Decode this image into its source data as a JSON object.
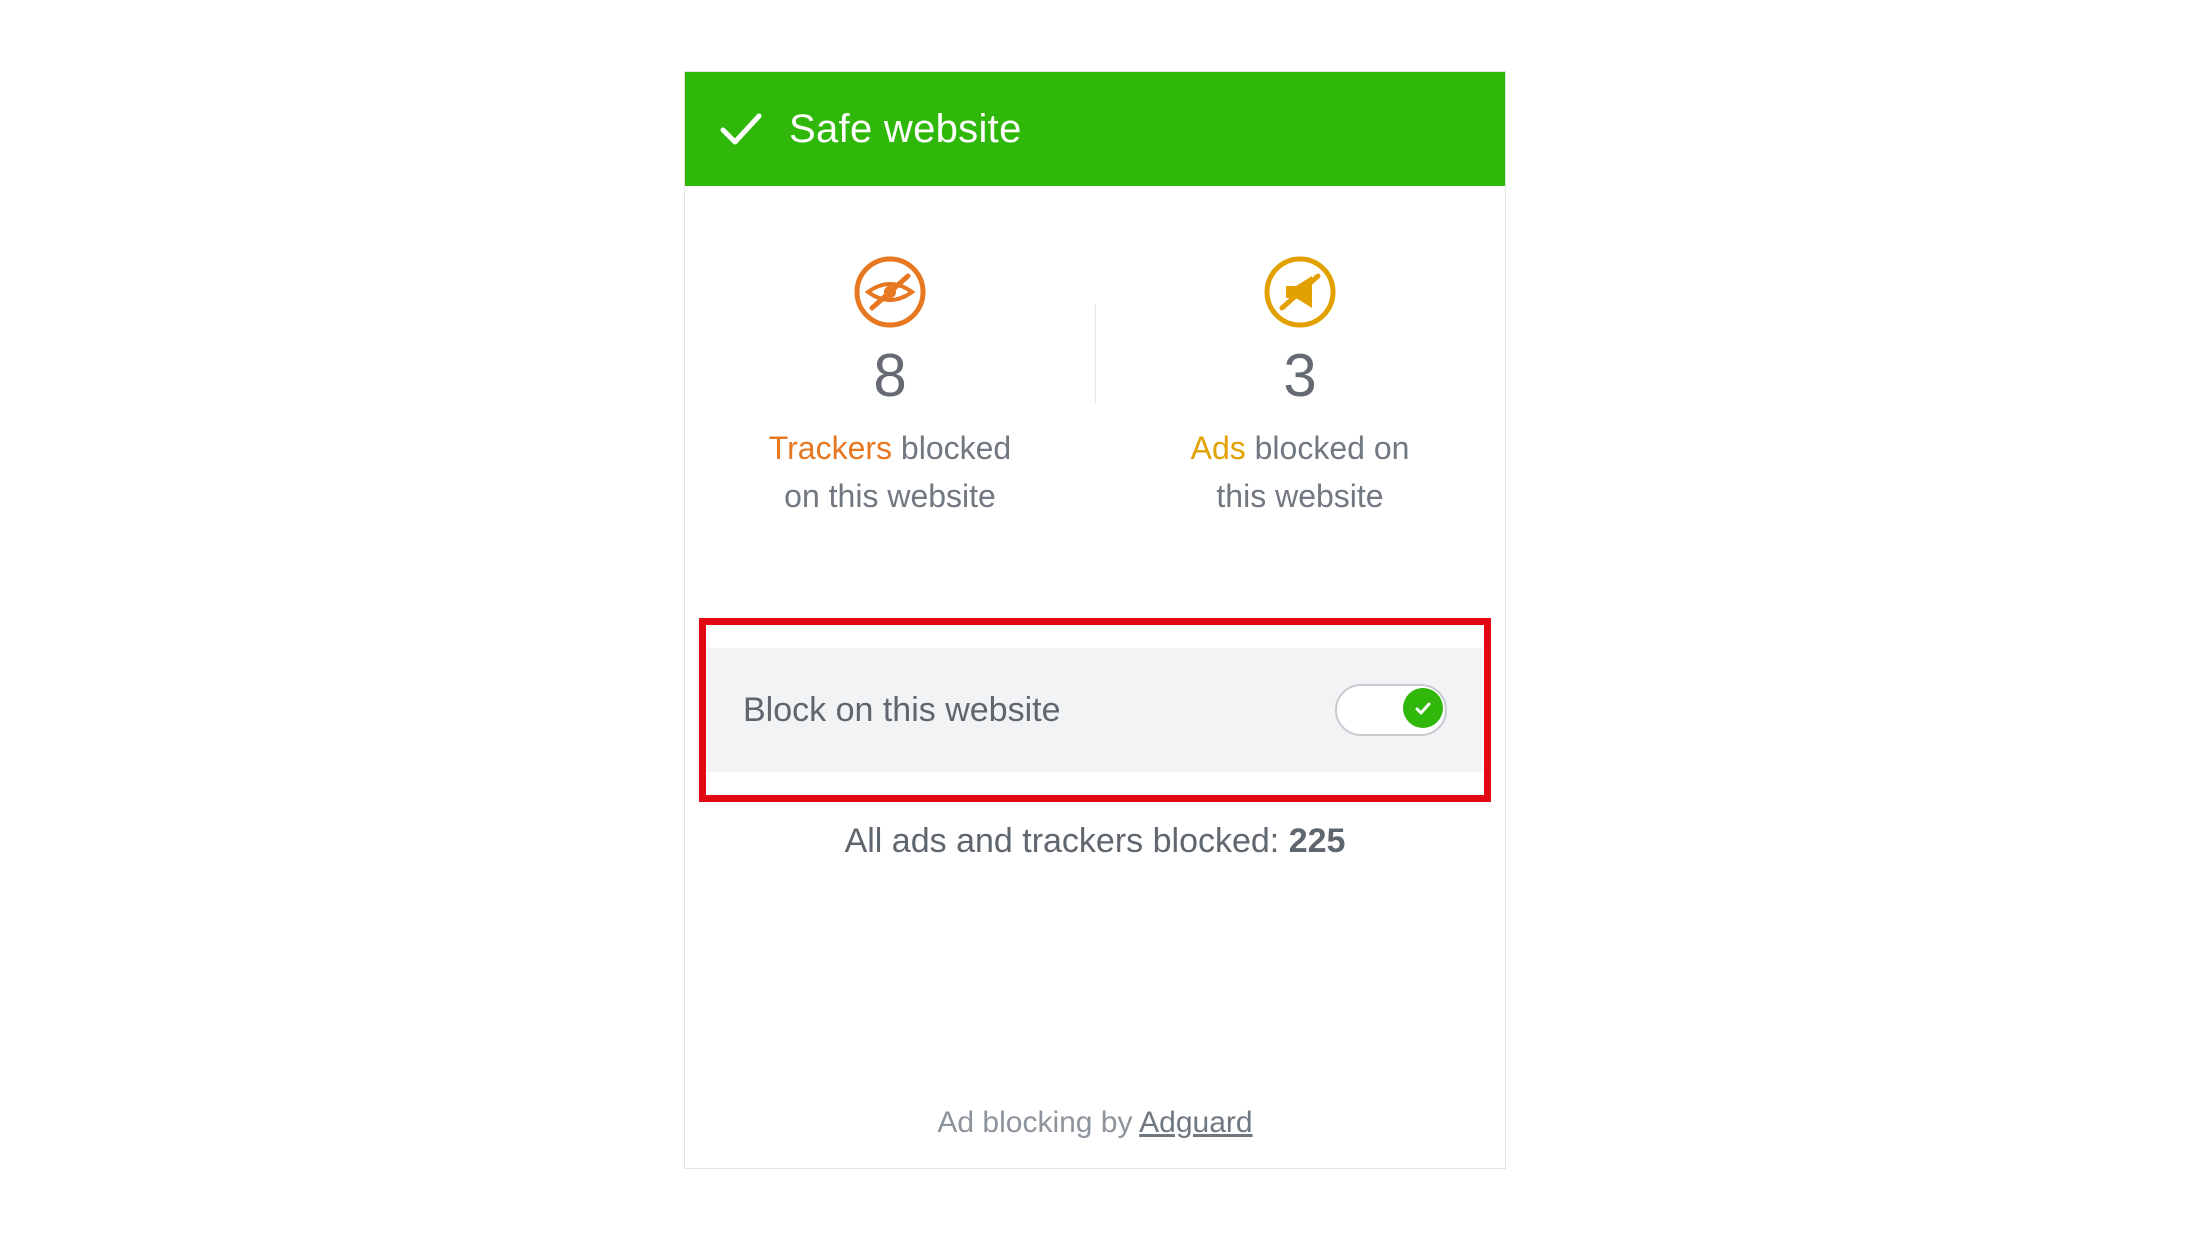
{
  "header": {
    "title": "Safe website"
  },
  "stats": {
    "trackers": {
      "count": "8",
      "label_accent": "Trackers",
      "label_line1_rest": " blocked",
      "label_line2": "on this website"
    },
    "ads": {
      "count": "3",
      "label_accent": "Ads",
      "label_line1_rest": " blocked on",
      "label_line2": "this website"
    }
  },
  "toggle": {
    "label": "Block on this website",
    "on": true
  },
  "totals": {
    "text": "All ads and trackers blocked: ",
    "value": "225"
  },
  "footer": {
    "prefix": "Ad blocking by ",
    "link": "Adguard"
  }
}
